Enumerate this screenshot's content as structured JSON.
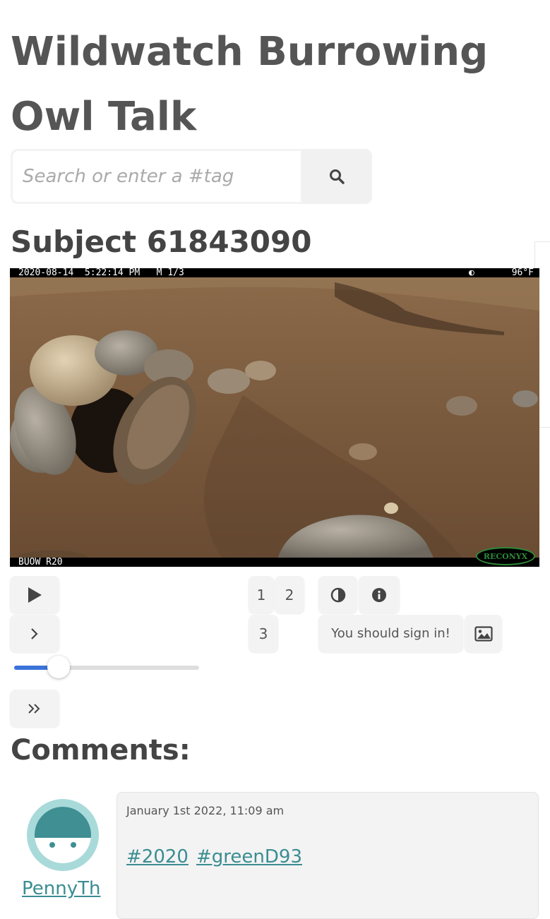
{
  "header": {
    "title": "Wildwatch Burrowing Owl Talk"
  },
  "search": {
    "placeholder": "Search or enter a #tag"
  },
  "subject": {
    "title": "Subject 61843090",
    "image": {
      "stamp_top": "2020-08-14  5:22:14 PM   M 1/3",
      "temperature": "96°F",
      "stamp_bottom": "BUOW R20",
      "brand": "RECONYX"
    }
  },
  "controls": {
    "play_icon": "play-icon",
    "next_icon": "chevron-right-icon",
    "last_icon": "double-chevron-right-icon",
    "frames": [
      "1",
      "2",
      "3"
    ],
    "contrast_icon": "contrast-icon",
    "info_icon": "info-icon",
    "sign_in_label": "You should sign in!",
    "image_icon": "image-icon",
    "slider_progress": 0.24
  },
  "comments": {
    "heading": "Comments:",
    "items": [
      {
        "user": "PennyTh",
        "date": "January 1st 2022, 11:09 am",
        "tags": [
          "#2020",
          "#greenD93"
        ]
      }
    ]
  },
  "colors": {
    "link": "#3a8d92",
    "slider": "#3b73d8",
    "avatar_bg": "#a9dada",
    "avatar_face": "#3f8f93"
  }
}
